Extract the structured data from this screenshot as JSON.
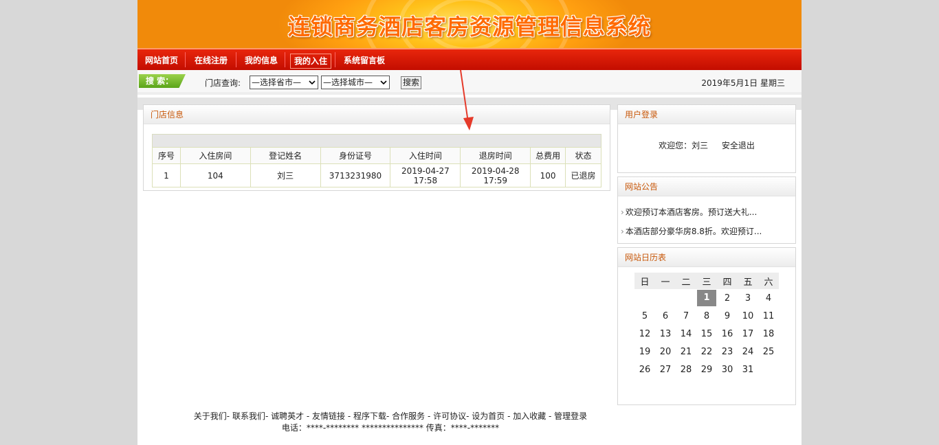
{
  "banner": {
    "title": "连锁商务酒店客房资源管理信息系统"
  },
  "nav": {
    "items": [
      "网站首页",
      "在线注册",
      "我的信息",
      "我的入住",
      "系统留言板"
    ],
    "active_index": 3
  },
  "search": {
    "tag": "搜 索：",
    "label": "门店查询:",
    "province_select": "—选择省市—",
    "city_select": "—选择城市—",
    "button": "搜索",
    "date": "2019年5月1日 星期三"
  },
  "store_panel": {
    "title": "门店信息",
    "columns": [
      "序号",
      "入住房间",
      "登记姓名",
      "身份证号",
      "入住时间",
      "退房时间",
      "总费用",
      "状态"
    ],
    "rows": [
      {
        "no": "1",
        "room": "104",
        "name": "刘三",
        "id": "3713231980",
        "checkin_date": "2019-04-27",
        "checkin_time": "17:58",
        "checkout_date": "2019-04-28",
        "checkout_time": "17:59",
        "fee": "100",
        "status": "已退房"
      }
    ]
  },
  "login_panel": {
    "title": "用户登录",
    "welcome": "欢迎您：刘三",
    "logout": "安全退出"
  },
  "notice_panel": {
    "title": "网站公告",
    "items": [
      "欢迎预订本酒店客房。预订送大礼...",
      "本酒店部分豪华房8.8折。欢迎预订..."
    ]
  },
  "calendar_panel": {
    "title": "网站日历表",
    "weekdays": [
      "日",
      "一",
      "二",
      "三",
      "四",
      "五",
      "六"
    ],
    "weeks": [
      [
        "",
        "",
        "",
        "1",
        "2",
        "3",
        "4"
      ],
      [
        "5",
        "6",
        "7",
        "8",
        "9",
        "10",
        "11"
      ],
      [
        "12",
        "13",
        "14",
        "15",
        "16",
        "17",
        "18"
      ],
      [
        "19",
        "20",
        "21",
        "22",
        "23",
        "24",
        "25"
      ],
      [
        "26",
        "27",
        "28",
        "29",
        "30",
        "31",
        ""
      ]
    ],
    "today": "1"
  },
  "footer": {
    "links": [
      "关于我们",
      "联系我们",
      "诚聘英才",
      "友情链接",
      "程序下载",
      "合作服务",
      "许可协议",
      "设为首页",
      "加入收藏",
      "管理登录"
    ],
    "line1": "关于我们- 联系我们- 诚聘英才 - 友情链接 - 程序下载- 合作服务 - 许可协议- 设为首页 - 加入收藏 - 管理登录",
    "line2": "电话：****-******** *************** 传真：****-*******"
  },
  "colors": {
    "nav_red": "#d61a05",
    "accent_orange": "#c8580a",
    "search_green": "#6fb52a",
    "arrow_red": "#e53a2a"
  }
}
